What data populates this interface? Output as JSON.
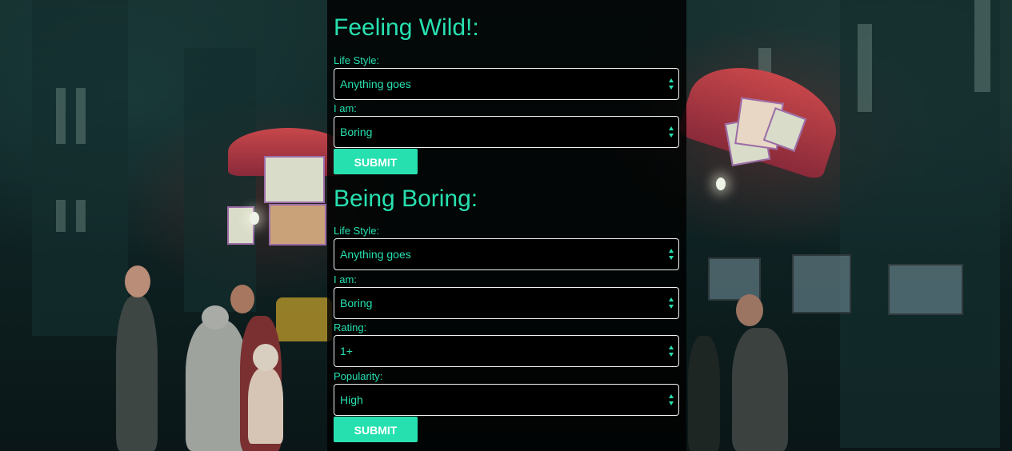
{
  "colors": {
    "accent": "#27e0b0",
    "panel_bg": "#000000",
    "field_border": "#f2f2f2"
  },
  "wild_section": {
    "title": "Feeling Wild!:",
    "fields": [
      {
        "label": "Life Style:",
        "value": "Anything goes"
      },
      {
        "label": "I am:",
        "value": "Boring"
      }
    ],
    "submit_label": "SUBMIT"
  },
  "boring_section": {
    "title": "Being Boring:",
    "fields": [
      {
        "label": "Life Style:",
        "value": "Anything goes"
      },
      {
        "label": "I am:",
        "value": "Boring"
      },
      {
        "label": "Rating:",
        "value": "1+"
      },
      {
        "label": "Popularity:",
        "value": "High"
      }
    ],
    "submit_label": "SUBMIT"
  },
  "icons": {
    "select_arrow": "select-arrows-icon"
  }
}
